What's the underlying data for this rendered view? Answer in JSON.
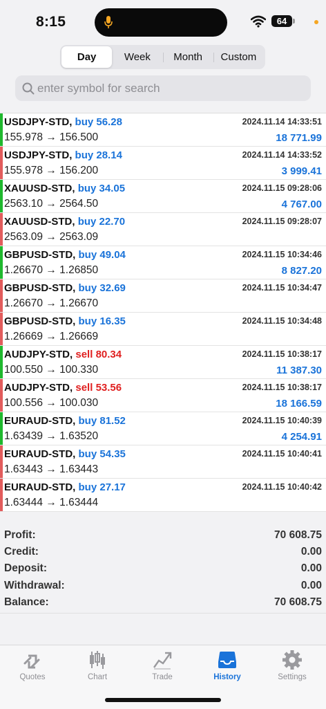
{
  "status_bar": {
    "time": "8:15",
    "battery": "64"
  },
  "tabs": [
    {
      "label": "Day",
      "active": true
    },
    {
      "label": "Week",
      "active": false
    },
    {
      "label": "Month",
      "active": false
    },
    {
      "label": "Custom",
      "active": false
    }
  ],
  "search": {
    "placeholder": "enter symbol for search",
    "value": ""
  },
  "deals": [
    {
      "symbol": "USDJPY-STD,",
      "direction": "buy",
      "volume": "56.28",
      "prices": "155.978 → 156.500",
      "datetime": "2024.11.14 14:33:51",
      "profit": "18 771.99",
      "bar_color": "#1fb82e"
    },
    {
      "symbol": "USDJPY-STD,",
      "direction": "buy",
      "volume": "28.14",
      "prices": "155.978 → 156.200",
      "datetime": "2024.11.14 14:33:52",
      "profit": "3 999.41",
      "bar_color": "#e25c5c"
    },
    {
      "symbol": "XAUUSD-STD,",
      "direction": "buy",
      "volume": "34.05",
      "prices": "2563.10 → 2564.50",
      "datetime": "2024.11.15 09:28:06",
      "profit": "4 767.00",
      "bar_color": "#1fb82e"
    },
    {
      "symbol": "XAUUSD-STD,",
      "direction": "buy",
      "volume": "22.70",
      "prices": "2563.09 → 2563.09",
      "datetime": "2024.11.15 09:28:07",
      "profit": "",
      "bar_color": "#e25c5c"
    },
    {
      "symbol": "GBPUSD-STD,",
      "direction": "buy",
      "volume": "49.04",
      "prices": "1.26670 → 1.26850",
      "datetime": "2024.11.15 10:34:46",
      "profit": "8 827.20",
      "bar_color": "#1fb82e"
    },
    {
      "symbol": "GBPUSD-STD,",
      "direction": "buy",
      "volume": "32.69",
      "prices": "1.26670 → 1.26670",
      "datetime": "2024.11.15 10:34:47",
      "profit": "",
      "bar_color": "#e25c5c"
    },
    {
      "symbol": "GBPUSD-STD,",
      "direction": "buy",
      "volume": "16.35",
      "prices": "1.26669 → 1.26669",
      "datetime": "2024.11.15 10:34:48",
      "profit": "",
      "bar_color": "#e25c5c"
    },
    {
      "symbol": "AUDJPY-STD,",
      "direction": "sell",
      "volume": "80.34",
      "prices": "100.550 → 100.330",
      "datetime": "2024.11.15 10:38:17",
      "profit": "11 387.30",
      "bar_color": "#1fb82e"
    },
    {
      "symbol": "AUDJPY-STD,",
      "direction": "sell",
      "volume": "53.56",
      "prices": "100.556 → 100.030",
      "datetime": "2024.11.15 10:38:17",
      "profit": "18 166.59",
      "bar_color": "#e25c5c"
    },
    {
      "symbol": "EURAUD-STD,",
      "direction": "buy",
      "volume": "81.52",
      "prices": "1.63439 → 1.63520",
      "datetime": "2024.11.15 10:40:39",
      "profit": "4 254.91",
      "bar_color": "#1fb82e"
    },
    {
      "symbol": "EURAUD-STD,",
      "direction": "buy",
      "volume": "54.35",
      "prices": "1.63443 → 1.63443",
      "datetime": "2024.11.15 10:40:41",
      "profit": "",
      "bar_color": "#e25c5c"
    },
    {
      "symbol": "EURAUD-STD,",
      "direction": "buy",
      "volume": "27.17",
      "prices": "1.63444 → 1.63444",
      "datetime": "2024.11.15 10:40:42",
      "profit": "",
      "bar_color": "#e25c5c"
    }
  ],
  "summary": [
    {
      "label": "Profit:",
      "value": "70 608.75"
    },
    {
      "label": "Credit:",
      "value": "0.00"
    },
    {
      "label": "Deposit:",
      "value": "0.00"
    },
    {
      "label": "Withdrawal:",
      "value": "0.00"
    },
    {
      "label": "Balance:",
      "value": "70 608.75"
    }
  ],
  "tab_bar": [
    {
      "label": "Quotes",
      "icon": "quotes-icon",
      "active": false
    },
    {
      "label": "Chart",
      "icon": "chart-icon",
      "active": false
    },
    {
      "label": "Trade",
      "icon": "trade-icon",
      "active": false
    },
    {
      "label": "History",
      "icon": "history-icon",
      "active": true
    },
    {
      "label": "Settings",
      "icon": "settings-icon",
      "active": false
    }
  ],
  "colors": {
    "accent": "#1a73d9",
    "sell": "#e02020",
    "profit_bar": "#1fb82e",
    "loss_bar": "#e25c5c"
  }
}
